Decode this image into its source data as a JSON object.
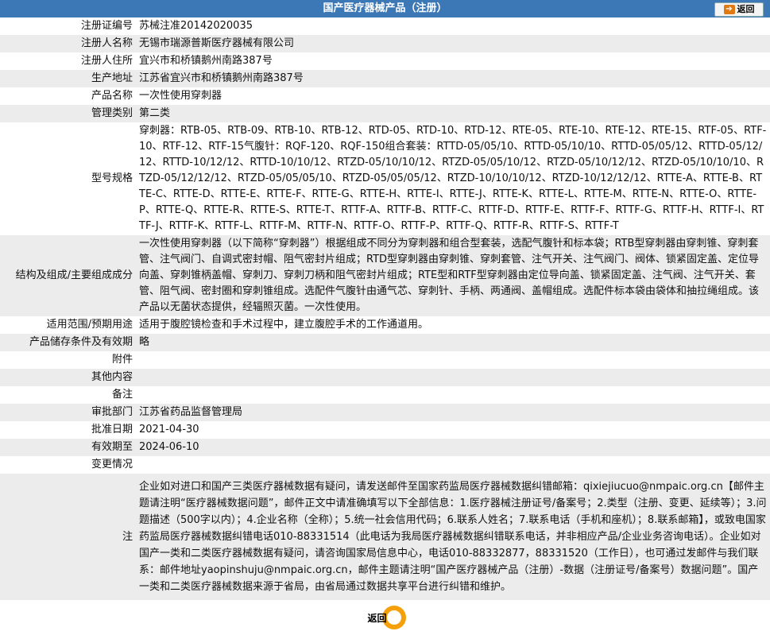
{
  "header": {
    "title": "国产医疗器械产品（注册）",
    "back_label": "返回"
  },
  "rows": [
    {
      "label": "注册证编号",
      "value": "苏械注准20142020035"
    },
    {
      "label": "注册人名称",
      "value": "无锡市瑞源普斯医疗器械有限公司"
    },
    {
      "label": "注册人住所",
      "value": "宜兴市和桥镇鹅州南路387号"
    },
    {
      "label": "生产地址",
      "value": "江苏省宜兴市和桥镇鹅州南路387号"
    },
    {
      "label": "产品名称",
      "value": "一次性使用穿刺器"
    },
    {
      "label": "管理类别",
      "value": "第二类"
    },
    {
      "label": "型号规格",
      "value": "穿刺器：RTB-05、RTB-09、RTB-10、RTB-12、RTD-05、RTD-10、RTD-12、RTE-05、RTE-10、RTE-12、RTE-15、RTF-05、RTF-10、RTF-12、RTF-15气腹针：RQF-120、RQF-150组合套装：RTTD-05/05/10、RTTD-05/10/10、RTTD-05/05/12、RTTD-05/12/12、RTTD-10/12/12、RTTD-10/10/12、RTZD-05/10/10/12、RTZD-05/05/10/12、RTZD-05/10/12/12、RTZD-05/10/10/10、RTZD-05/12/12/12、RTZD-05/05/05/10、RTZD-05/05/05/12、RTZD-10/10/10/12、RTZD-10/12/12/12、RTTE-A、RTTE-B、RTTE-C、RTTE-D、RTTE-E、RTTE-F、RTTE-G、RTTE-H、RTTE-I、RTTE-J、RTTE-K、RTTE-L、RTTE-M、RTTE-N、RTTE-O、RTTE-P、RTTE-Q、RTTE-R、RTTE-S、RTTE-T、RTTF-A、RTTF-B、RTTF-C、RTTF-D、RTTF-E、RTTF-F、RTTF-G、RTTF-H、RTTF-I、RTTF-J、RTTF-K、RTTF-L、RTTF-M、RTTF-N、RTTF-O、RTTF-P、RTTF-Q、RTTF-R、RTTF-S、RTTF-T"
    },
    {
      "label": "结构及组成/主要组成成分",
      "value": "一次性使用穿刺器（以下简称“穿刺器”）根据组成不同分为穿刺器和组合型套装，选配气腹针和标本袋；RTB型穿刺器由穿刺锥、穿刺套管、注气阀门、自调式密封帽、阻气密封片组成；RTD型穿刺器由穿刺锥、穿刺套管、注气开关、注气阀门、阀体、锁紧固定盖、定位导向盖、穿刺锥柄盖帽、穿刺刀、穿刺刀柄和阻气密封片组成；RTE型和RTF型穿刺器由定位导向盖、锁紧固定盖、注气阀、注气开关、套管、阻气阀、密封圈和穿刺锥组成。选配件气腹针由通气芯、穿刺针、手柄、两通阀、盖帽组成。选配件标本袋由袋体和抽拉绳组成。该产品以无菌状态提供，经辐照灭菌。一次性使用。"
    },
    {
      "label": "适用范围/预期用途",
      "value": "适用于腹腔镜检查和手术过程中，建立腹腔手术的工作通道用。"
    },
    {
      "label": "产品储存条件及有效期",
      "value": "略"
    },
    {
      "label": "附件",
      "value": ""
    },
    {
      "label": "其他内容",
      "value": ""
    },
    {
      "label": "备注",
      "value": ""
    },
    {
      "label": "审批部门",
      "value": "江苏省药品监督管理局"
    },
    {
      "label": "批准日期",
      "value": "2021-04-30"
    },
    {
      "label": "有效期至",
      "value": "2024-06-10"
    },
    {
      "label": "变更情况",
      "value": ""
    }
  ],
  "note": {
    "label": "注",
    "text": "企业如对进口和国产三类医疗器械数据有疑问，请发送邮件至国家药监局医疗器械数据纠错邮箱：qixiejiucuo@nmpaic.org.cn【邮件主题请注明“医疗器械数据问题”，邮件正文中请准确填写以下全部信息：1.医疗器械注册证号/备案号；2.类型（注册、变更、延续等）；3.问题描述（500字以内）；4.企业名称（全称）；5.统一社会信用代码；6.联系人姓名；7.联系电话（手机和座机）；8.联系邮箱】，或致电国家药监局医疗器械数据纠错电话010-88331514（此电话为我局医疗器械数据纠错联系电话，并非相应产品/企业业务咨询电话）。企业如对国产一类和二类医疗器械数据有疑问，请咨询国家局信息中心，电话010-88332877，88331520（工作日），也可通过发邮件与我们联系：邮件地址yaopinshuju@nmpaic.org.cn，邮件主题请注明“国产医疗器械产品（注册）-数据（注册证号/备案号）数据问题”。国产一类和二类医疗器械数据来源于省局，由省局通过数据共享平台进行纠错和维护。"
  },
  "footer": {
    "back_label": "返回"
  }
}
